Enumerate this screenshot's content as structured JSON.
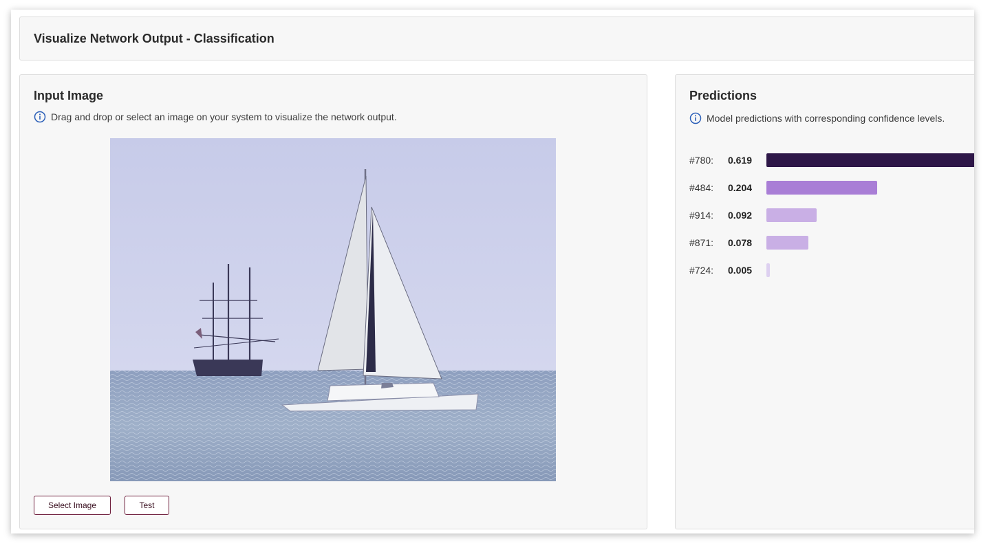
{
  "header": {
    "title": "Visualize Network Output - Classification"
  },
  "input_panel": {
    "title": "Input Image",
    "info": "Drag and drop or select an image on your system to visualize the network output.",
    "select_button": "Select Image",
    "test_button": "Test"
  },
  "predictions_panel": {
    "title": "Predictions",
    "info": "Model predictions with corresponding confidence levels.",
    "items": [
      {
        "id": "#780:",
        "value": "0.619",
        "confidence": 0.619,
        "color": "#2e1748"
      },
      {
        "id": "#484:",
        "value": "0.204",
        "confidence": 0.204,
        "color": "#a97ed6"
      },
      {
        "id": "#914:",
        "value": "0.092",
        "confidence": 0.092,
        "color": "#c9afe5"
      },
      {
        "id": "#871:",
        "value": "0.078",
        "confidence": 0.078,
        "color": "#c9afe5"
      },
      {
        "id": "#724:",
        "value": "0.005",
        "confidence": 0.005,
        "color": "#ddd0f0"
      }
    ]
  },
  "icons": {
    "info": "info-circle-icon"
  }
}
